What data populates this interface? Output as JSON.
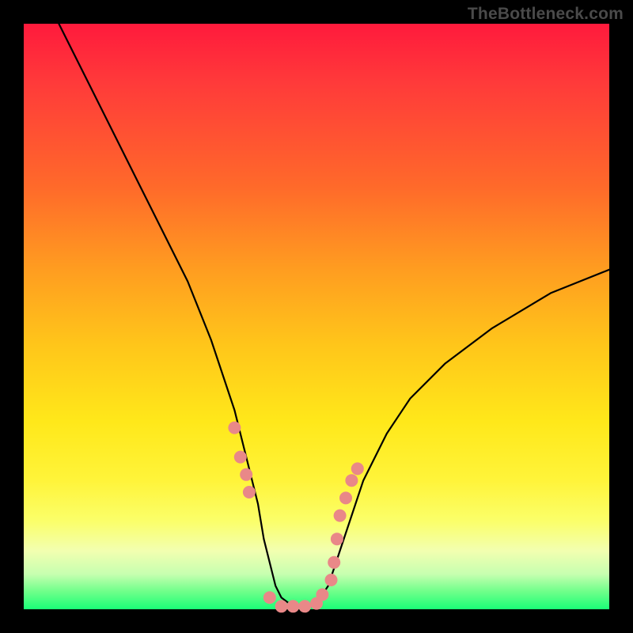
{
  "watermark": "TheBottleneck.com",
  "chart_data": {
    "type": "line",
    "title": "",
    "xlabel": "",
    "ylabel": "",
    "xlim": [
      0,
      100
    ],
    "ylim": [
      0,
      100
    ],
    "grid": false,
    "series": [
      {
        "name": "bottleneck-curve",
        "x": [
          6,
          8,
          12,
          16,
          20,
          24,
          28,
          32,
          34,
          36,
          38,
          40,
          41,
          42,
          43,
          44,
          46,
          48,
          50,
          52,
          54,
          56,
          58,
          62,
          66,
          72,
          80,
          90,
          100
        ],
        "y": [
          100,
          96,
          88,
          80,
          72,
          64,
          56,
          46,
          40,
          34,
          26,
          18,
          12,
          8,
          4,
          2,
          0.5,
          0.5,
          1,
          4,
          10,
          16,
          22,
          30,
          36,
          42,
          48,
          54,
          58
        ],
        "color": "#000000"
      }
    ],
    "points": {
      "name": "highlight-dots",
      "color": "#e98888",
      "radius_px": 8,
      "x": [
        36.0,
        37.0,
        38.0,
        38.5,
        42.0,
        44.0,
        46.0,
        48.0,
        50.0,
        51.0,
        52.5,
        53.0,
        53.5,
        54.0,
        55.0,
        56.0,
        57.0
      ],
      "y": [
        31.0,
        26.0,
        23.0,
        20.0,
        2.0,
        0.5,
        0.5,
        0.5,
        1.0,
        2.5,
        5.0,
        8.0,
        12.0,
        16.0,
        19.0,
        22.0,
        24.0
      ]
    }
  }
}
